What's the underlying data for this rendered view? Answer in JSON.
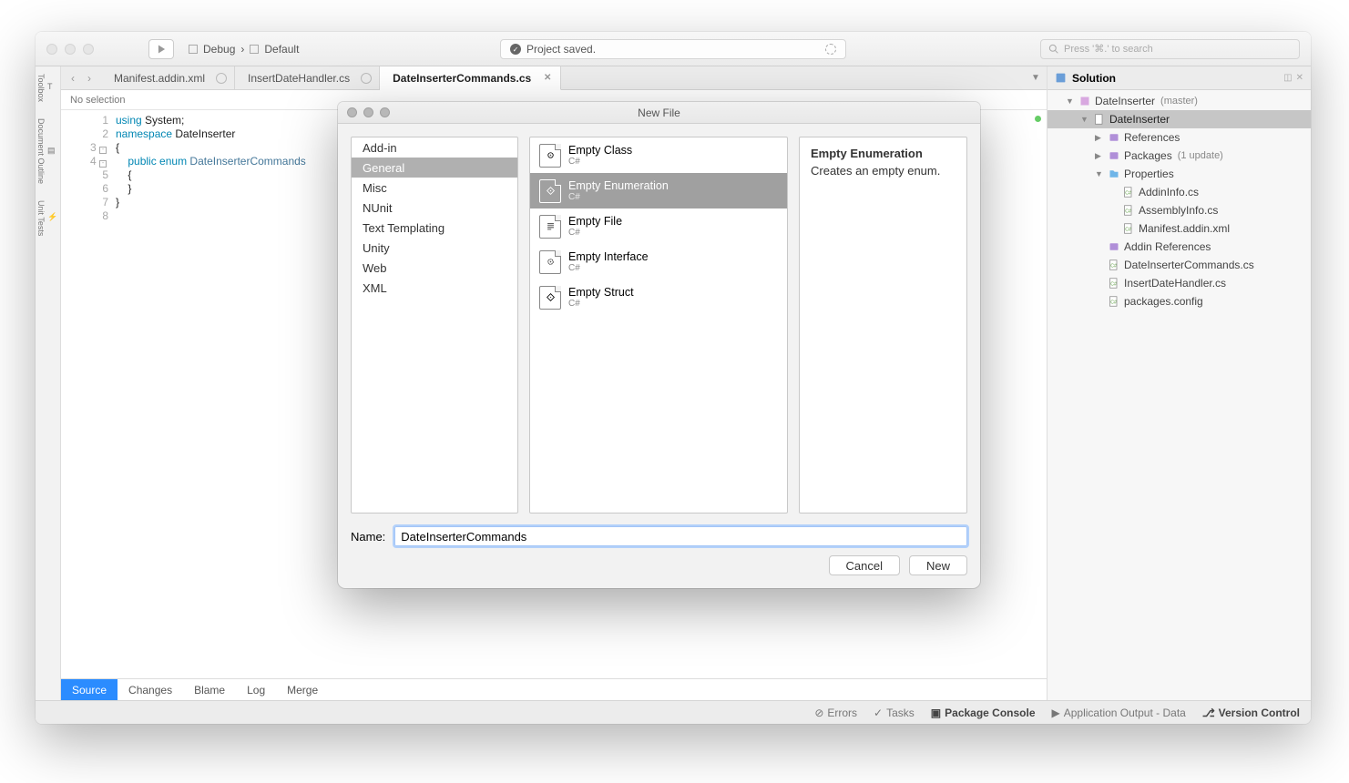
{
  "titlebar": {
    "config_build": "Debug",
    "config_target": "Default",
    "status_text": "Project saved.",
    "search_placeholder": "Press '⌘.' to search"
  },
  "left_rail": [
    "Toolbox",
    "Document Outline",
    "Unit Tests"
  ],
  "tabs": [
    {
      "label": "Manifest.addin.xml",
      "active": false
    },
    {
      "label": "InsertDateHandler.cs",
      "active": false
    },
    {
      "label": "DateInserterCommands.cs",
      "active": true
    }
  ],
  "breadcrumb": "No selection",
  "code": {
    "lines": [
      {
        "n": "1",
        "html": "<span class='kw'>using</span> System;"
      },
      {
        "n": "2",
        "html": "<span class='kw'>namespace</span> DateInserter"
      },
      {
        "n": "3",
        "html": "{",
        "fold": true
      },
      {
        "n": "4",
        "html": "    <span class='kw'>public</span> <span class='kw'>enum</span> <span class='ty'>DateInserterCommands</span>",
        "fold": true
      },
      {
        "n": "5",
        "html": "    {"
      },
      {
        "n": "6",
        "html": "    }"
      },
      {
        "n": "7",
        "html": "}"
      },
      {
        "n": "8",
        "html": ""
      }
    ]
  },
  "bottom_tabs": [
    "Source",
    "Changes",
    "Blame",
    "Log",
    "Merge"
  ],
  "solution": {
    "title": "Solution",
    "root": {
      "label": "DateInserter",
      "note": "(master)"
    },
    "project": "DateInserter",
    "refs": "References",
    "packages": {
      "label": "Packages",
      "note": "(1 update)"
    },
    "props": "Properties",
    "prop_files": [
      "AddinInfo.cs",
      "AssemblyInfo.cs",
      "Manifest.addin.xml"
    ],
    "addin_refs": "Addin References",
    "files": [
      "DateInserterCommands.cs",
      "InsertDateHandler.cs",
      "packages.config"
    ]
  },
  "statusbar": {
    "errors": "Errors",
    "tasks": "Tasks",
    "console": "Package Console",
    "output": "Application Output - Data",
    "vcs": "Version Control"
  },
  "dialog": {
    "title": "New File",
    "categories": [
      "Add-in",
      "General",
      "Misc",
      "NUnit",
      "Text Templating",
      "Unity",
      "Web",
      "XML"
    ],
    "selected_category": "General",
    "templates": [
      {
        "label": "Empty Class",
        "sub": "C#"
      },
      {
        "label": "Empty Enumeration",
        "sub": "C#"
      },
      {
        "label": "Empty File",
        "sub": "C#"
      },
      {
        "label": "Empty Interface",
        "sub": "C#"
      },
      {
        "label": "Empty Struct",
        "sub": "C#"
      }
    ],
    "selected_template": "Empty Enumeration",
    "description": {
      "title": "Empty Enumeration",
      "body": "Creates an empty enum."
    },
    "name_label": "Name:",
    "name_value": "DateInserterCommands",
    "cancel": "Cancel",
    "new": "New"
  }
}
